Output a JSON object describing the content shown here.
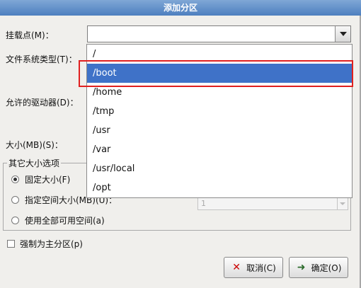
{
  "dialog": {
    "title": "添加分区"
  },
  "form": {
    "mount_point_label": "挂载点(M)：",
    "mount_point_value": "",
    "fs_type_label": "文件系统类型(T)：",
    "drives_label": "允许的驱动器(D)：",
    "size_label": "大小(MB)(S)："
  },
  "dropdown": {
    "options": [
      "/",
      "/boot",
      "/home",
      "/tmp",
      "/usr",
      "/var",
      "/usr/local",
      "/opt"
    ],
    "selected": "/boot"
  },
  "size_options": {
    "legend": "其它大小选项",
    "fixed_label": "固定大小(F)",
    "fill_to_label": "指定空间大小(MB)(U)：",
    "fill_all_label": "使用全部可用空间(a)",
    "fill_to_value": "1",
    "selected": "fixed"
  },
  "force_primary_label": "强制为主分区(p)",
  "buttons": {
    "cancel_label": "取消(C)",
    "ok_label": "确定(O)"
  }
}
